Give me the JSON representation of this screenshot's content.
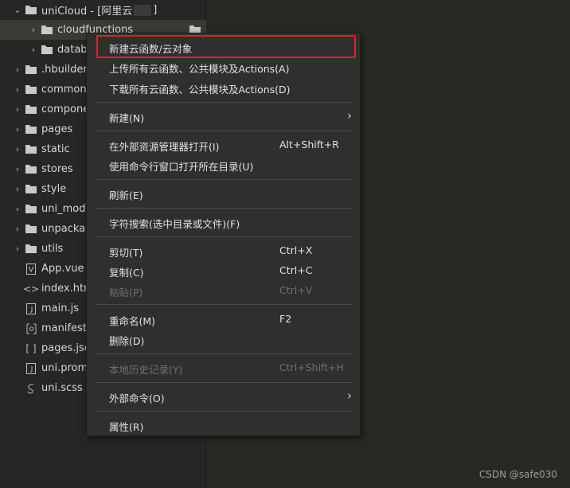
{
  "explorer": {
    "items": [
      {
        "label": "uniCloud - [阿里云",
        "icon": "folder-open-icon",
        "chevron": "down",
        "depth": 0
      },
      {
        "label": "cloudfunctions",
        "icon": "folder-icon",
        "chevron": "right",
        "depth": 1,
        "selected": true
      },
      {
        "label": "datab",
        "icon": "folder-icon",
        "chevron": "right",
        "depth": 1
      },
      {
        "label": ".hbuilderx",
        "icon": "folder-icon",
        "chevron": "right",
        "depth": 0
      },
      {
        "label": "common",
        "icon": "folder-icon",
        "chevron": "right",
        "depth": 0
      },
      {
        "label": "compone",
        "icon": "folder-icon",
        "chevron": "right",
        "depth": 0
      },
      {
        "label": "pages",
        "icon": "folder-icon",
        "chevron": "right",
        "depth": 0
      },
      {
        "label": "static",
        "icon": "folder-icon",
        "chevron": "right",
        "depth": 0
      },
      {
        "label": "stores",
        "icon": "folder-icon",
        "chevron": "right",
        "depth": 0
      },
      {
        "label": "style",
        "icon": "folder-icon",
        "chevron": "right",
        "depth": 0
      },
      {
        "label": "uni_modu",
        "icon": "folder-icon",
        "chevron": "right",
        "depth": 0
      },
      {
        "label": "unpackag",
        "icon": "folder-icon",
        "chevron": "right",
        "depth": 0
      },
      {
        "label": "utils",
        "icon": "folder-icon",
        "chevron": "right",
        "depth": 0
      },
      {
        "label": "App.vue",
        "icon": "vue-file-icon",
        "chevron": "",
        "depth": 0
      },
      {
        "label": "index.htm",
        "icon": "html-file-icon",
        "chevron": "",
        "depth": 0
      },
      {
        "label": "main.js",
        "icon": "js-file-icon",
        "chevron": "",
        "depth": 0
      },
      {
        "label": "manifest.",
        "icon": "manifest-file-icon",
        "chevron": "",
        "depth": 0
      },
      {
        "label": "pages.jsc",
        "icon": "json-file-icon",
        "chevron": "",
        "depth": 0
      },
      {
        "label": "uni.prom",
        "icon": "file-icon",
        "chevron": "",
        "depth": 0
      },
      {
        "label": "uni.scss",
        "icon": "scss-file-icon",
        "chevron": "",
        "depth": 0
      }
    ],
    "root_suffix": "]"
  },
  "context_menu": {
    "items": [
      {
        "label": "新建云函数/云对象",
        "shortcut": "",
        "submenu": false,
        "disabled": false,
        "highlighted": true
      },
      {
        "label": "上传所有云函数、公共模块及Actions(A)",
        "shortcut": "",
        "submenu": false,
        "disabled": false
      },
      {
        "label": "下载所有云函数、公共模块及Actions(D)",
        "shortcut": "",
        "submenu": false,
        "disabled": false
      },
      {
        "label": "新建(N)",
        "shortcut": "",
        "submenu": true,
        "disabled": false
      },
      {
        "label": "在外部资源管理器打开(I)",
        "shortcut": "Alt+Shift+R",
        "submenu": false,
        "disabled": false
      },
      {
        "label": "使用命令行窗口打开所在目录(U)",
        "shortcut": "",
        "submenu": false,
        "disabled": false
      },
      {
        "label": "刷新(E)",
        "shortcut": "",
        "submenu": false,
        "disabled": false
      },
      {
        "label": "字符搜索(选中目录或文件)(F)",
        "shortcut": "",
        "submenu": false,
        "disabled": false
      },
      {
        "label": "剪切(T)",
        "shortcut": "Ctrl+X",
        "submenu": false,
        "disabled": false
      },
      {
        "label": "复制(C)",
        "shortcut": "Ctrl+C",
        "submenu": false,
        "disabled": false
      },
      {
        "label": "粘贴(P)",
        "shortcut": "Ctrl+V",
        "submenu": false,
        "disabled": true
      },
      {
        "label": "重命名(M)",
        "shortcut": "F2",
        "submenu": false,
        "disabled": false
      },
      {
        "label": "删除(D)",
        "shortcut": "",
        "submenu": false,
        "disabled": false
      },
      {
        "label": "本地历史记录(Y)",
        "shortcut": "Ctrl+Shift+H",
        "submenu": false,
        "disabled": true
      },
      {
        "label": "外部命令(O)",
        "shortcut": "",
        "submenu": true,
        "disabled": false
      },
      {
        "label": "属性(R)",
        "shortcut": "",
        "submenu": false,
        "disabled": false
      }
    ]
  },
  "watermark": "CSDN @safe030",
  "colors": {
    "highlight_border": "#e0202a",
    "menu_bg": "#2f302d",
    "sidebar_bg": "#262724"
  }
}
